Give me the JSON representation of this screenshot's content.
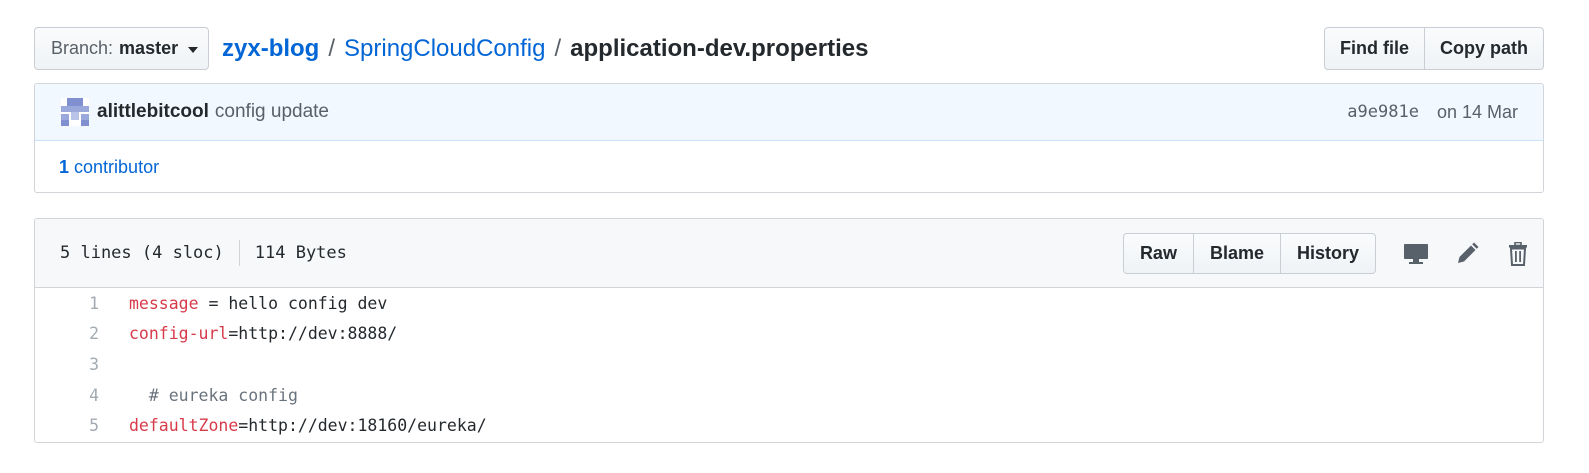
{
  "branch": {
    "label": "Branch:",
    "name": "master"
  },
  "breadcrumb": {
    "repo": "zyx-blog",
    "sep1": "/",
    "folder": "SpringCloudConfig",
    "sep2": "/",
    "file": "application-dev.properties"
  },
  "top_actions": {
    "find_file": "Find file",
    "copy_path": "Copy path"
  },
  "commit": {
    "author": "alittlebitcool",
    "message": "config update",
    "sha": "a9e981e",
    "date": "on 14 Mar"
  },
  "contributors": {
    "count": "1",
    "label": "contributor"
  },
  "file": {
    "lines_info": "5 lines (4 sloc)",
    "size": "114 Bytes",
    "actions": {
      "raw": "Raw",
      "blame": "Blame",
      "history": "History"
    },
    "icons": [
      "desktop-icon",
      "pencil-icon",
      "trash-icon"
    ]
  },
  "code_lines": [
    {
      "num": "1",
      "key": "message",
      "rest": " = hello config dev"
    },
    {
      "num": "2",
      "key": "config-url",
      "rest": "=http://dev:8888/"
    },
    {
      "num": "3",
      "key": "",
      "rest": ""
    },
    {
      "num": "4",
      "key": "",
      "rest": "",
      "comment": "  # eureka config"
    },
    {
      "num": "5",
      "key": "defaultZone",
      "rest": "=http://dev:18160/eureka/"
    }
  ],
  "colors": {
    "link": "#0366d6",
    "key": "#d73a49",
    "commit_bg": "#f1f8ff",
    "header_bg": "#f6f8fa"
  }
}
